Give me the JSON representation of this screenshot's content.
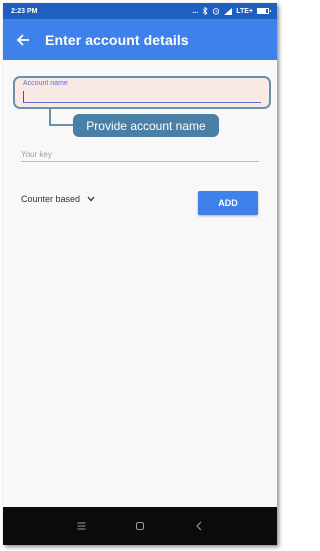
{
  "status_bar": {
    "time": "2:23 PM",
    "indicators": "...",
    "network": "LTE+",
    "battery_level": 0.75,
    "icons": [
      "bluetooth-icon",
      "alarm-icon",
      "signal-icon",
      "battery-icon"
    ]
  },
  "app_bar": {
    "title": "Enter account details",
    "back_icon": "arrow-left-icon"
  },
  "form": {
    "account_name_label": "Account name",
    "account_name_value": "",
    "key_placeholder": "Your key",
    "key_type_selected": "Counter based",
    "add_button_label": "ADD"
  },
  "callout": {
    "text": "Provide account name"
  },
  "nav_bar": {
    "icons": [
      "menu-icon",
      "home-icon",
      "back-icon"
    ]
  },
  "colors": {
    "status_bar": "#1f5fc0",
    "app_bar": "#3f81ea",
    "accent": "#5a72d6",
    "callout": "#4a7fa6",
    "highlight_fill": "#f8e9e4"
  }
}
